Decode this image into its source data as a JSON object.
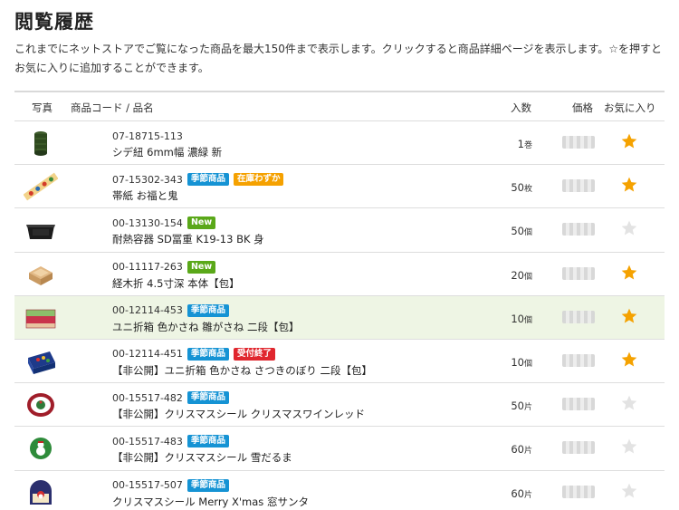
{
  "page": {
    "title": "閲覧履歴",
    "description": "これまでにネットストアでご覧になった商品を最大150件まで表示します。クリックすると商品詳細ページを表示します。☆を押すとお気に入りに追加することができます。"
  },
  "table": {
    "headers": {
      "photo": "写真",
      "code_name": "商品コード / 品名",
      "quantity": "入数",
      "price": "価格",
      "favorite": "お気に入り"
    },
    "rows": [
      {
        "code": "07-18715-113",
        "badges": [],
        "name": "シデ紐 6mm幅 濃緑 新",
        "qty": "1",
        "unit": "巻",
        "favorite": true,
        "thumbnail": "green-twine-spool",
        "highlighted": false
      },
      {
        "code": "07-15302-343",
        "badges": [
          {
            "label": "季節商品",
            "type": "seasonal"
          },
          {
            "label": "在庫わずか",
            "type": "lowstock"
          }
        ],
        "name": "帯紙 お福と鬼",
        "qty": "50",
        "unit": "枚",
        "favorite": true,
        "thumbnail": "setsubun-paper-band",
        "highlighted": false
      },
      {
        "code": "00-13130-154",
        "badges": [
          {
            "label": "New",
            "type": "new"
          }
        ],
        "name": "耐熱容器 SD冨重 K19-13 BK 身",
        "qty": "50",
        "unit": "個",
        "favorite": false,
        "thumbnail": "black-food-container",
        "highlighted": false
      },
      {
        "code": "00-11117-263",
        "badges": [
          {
            "label": "New",
            "type": "new"
          }
        ],
        "name": "経木折 4.5寸深 本体【包】",
        "qty": "20",
        "unit": "個",
        "favorite": true,
        "thumbnail": "wooden-box",
        "highlighted": false
      },
      {
        "code": "00-12114-453",
        "badges": [
          {
            "label": "季節商品",
            "type": "seasonal"
          }
        ],
        "name": "ユニ折箱 色かさね 雛がさね 二段【包】",
        "qty": "10",
        "unit": "個",
        "favorite": true,
        "thumbnail": "hina-two-tier-box",
        "highlighted": true
      },
      {
        "code": "00-12114-451",
        "badges": [
          {
            "label": "季節商品",
            "type": "seasonal"
          },
          {
            "label": "受付終了",
            "type": "closed"
          }
        ],
        "name": "【非公開】ユニ折箱 色かさね さつきのぼり 二段【包】",
        "qty": "10",
        "unit": "個",
        "favorite": true,
        "thumbnail": "satsuki-two-tier-box",
        "highlighted": false
      },
      {
        "code": "00-15517-482",
        "badges": [
          {
            "label": "季節商品",
            "type": "seasonal"
          }
        ],
        "name": "【非公開】クリスマスシール クリスマスワインレッド",
        "qty": "50",
        "unit": "片",
        "favorite": false,
        "thumbnail": "christmas-wine-seal",
        "highlighted": false
      },
      {
        "code": "00-15517-483",
        "badges": [
          {
            "label": "季節商品",
            "type": "seasonal"
          }
        ],
        "name": "【非公開】クリスマスシール 雪だるま",
        "qty": "60",
        "unit": "片",
        "favorite": false,
        "thumbnail": "snowman-seal",
        "highlighted": false
      },
      {
        "code": "00-15517-507",
        "badges": [
          {
            "label": "季節商品",
            "type": "seasonal"
          }
        ],
        "name": "クリスマスシール Merry X'mas 窓サンタ",
        "qty": "60",
        "unit": "片",
        "favorite": false,
        "thumbnail": "santa-window-seal",
        "highlighted": false
      }
    ]
  },
  "colors": {
    "star_on": "#f5a200",
    "star_off": "#e3e3e3",
    "highlight_row": "#eef5e4",
    "seasonal": "#1593d4",
    "new": "#5aa819",
    "lowstock": "#f5a100",
    "closed": "#e0262e"
  }
}
